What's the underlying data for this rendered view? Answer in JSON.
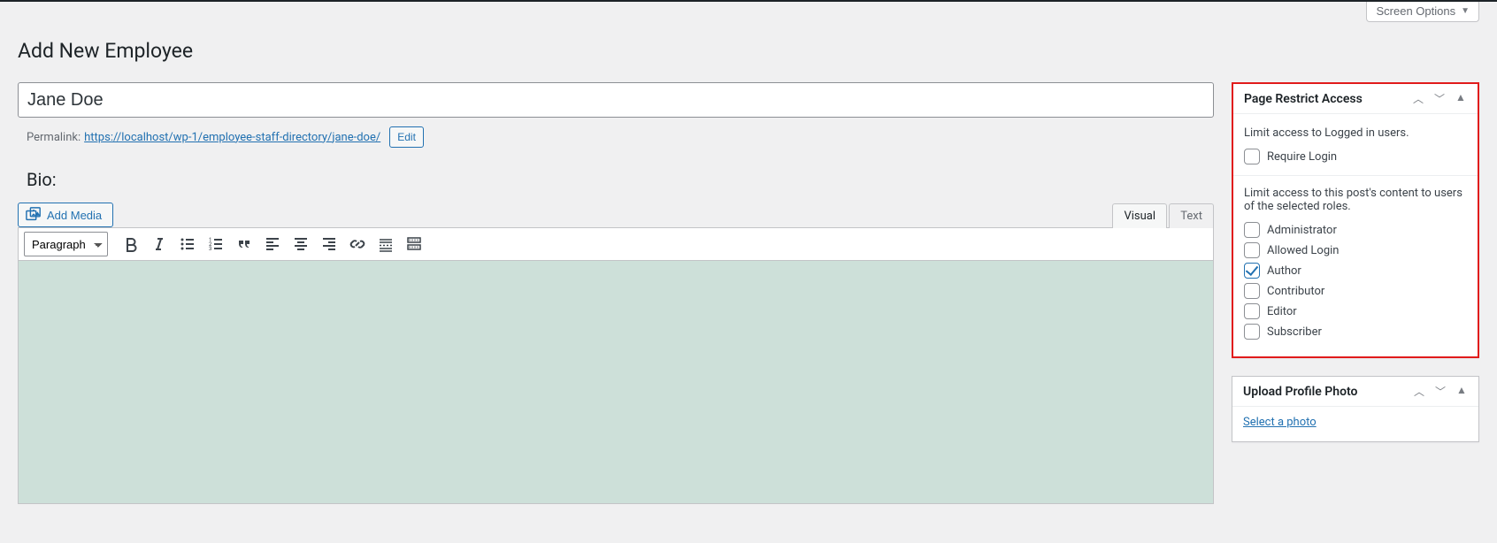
{
  "screenOptions": {
    "label": "Screen Options"
  },
  "page": {
    "title": "Add New Employee"
  },
  "post": {
    "title_value": "Jane Doe",
    "permalink_label": "Permalink:",
    "permalink_base": "https://localhost/wp-1/employee-staff-directory/",
    "permalink_slug": "jane-doe/",
    "edit_label": "Edit"
  },
  "bio": {
    "heading": "Bio:"
  },
  "media": {
    "add_label": "Add Media"
  },
  "editor": {
    "tabs": {
      "visual": "Visual",
      "text": "Text"
    },
    "format_selected": "Paragraph"
  },
  "restrictBox": {
    "title": "Page Restrict Access",
    "intro1": "Limit access to Logged in users.",
    "requireLogin": {
      "label": "Require Login",
      "checked": false
    },
    "intro2": "Limit access to this post's content to users of the selected roles.",
    "roles": [
      {
        "label": "Administrator",
        "checked": false
      },
      {
        "label": "Allowed Login",
        "checked": false
      },
      {
        "label": "Author",
        "checked": true
      },
      {
        "label": "Contributor",
        "checked": false
      },
      {
        "label": "Editor",
        "checked": false
      },
      {
        "label": "Subscriber",
        "checked": false
      }
    ]
  },
  "photoBox": {
    "title": "Upload Profile Photo",
    "link": "Select a photo"
  }
}
